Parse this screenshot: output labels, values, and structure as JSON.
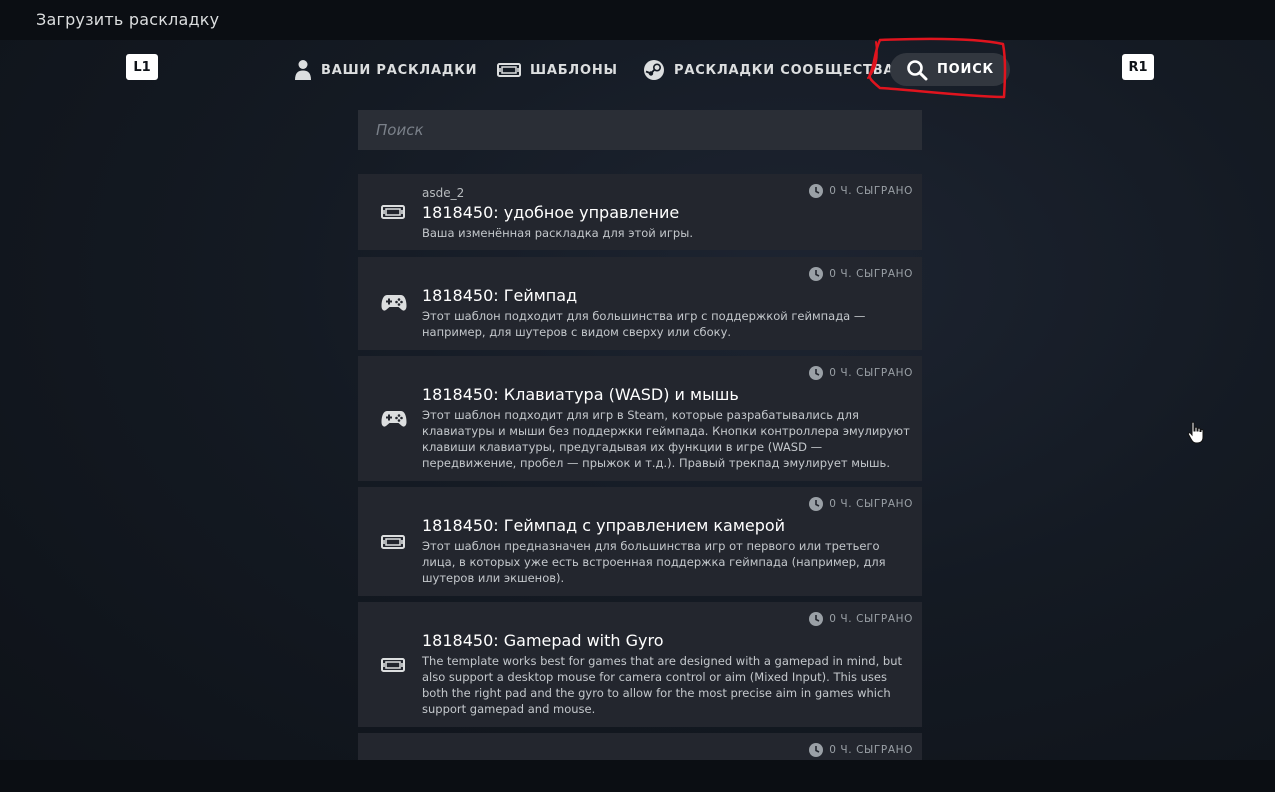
{
  "window": {
    "title": "Загрузить раскладку"
  },
  "shoulders": {
    "left": "L1",
    "right": "R1"
  },
  "tabs": [
    {
      "label": "ВАШИ РАСКЛАДКИ",
      "icon": "person-icon"
    },
    {
      "label": "ШАБЛОНЫ",
      "icon": "controller-outline-icon"
    },
    {
      "label": "РАСКЛАДКИ СООБЩЕСТВА",
      "icon": "steam-icon"
    },
    {
      "label": "ПОИСК",
      "icon": "search-icon",
      "active": true
    }
  ],
  "search": {
    "placeholder": "Поиск",
    "value": ""
  },
  "layouts": [
    {
      "author": "asde_2",
      "title": "1818450: удобное управление",
      "description": "Ваша изменённая раскладка для этой игры.",
      "played": "0 Ч. СЫГРАНО",
      "icon": "controller-outline-icon"
    },
    {
      "title": "1818450: Геймпад",
      "description": "Этот шаблон подходит для большинства игр с поддержкой геймпада — например, для шутеров с видом сверху или сбоку.",
      "played": "0 Ч. СЫГРАНО",
      "icon": "gamepad-icon"
    },
    {
      "title": "1818450: Клавиатура (WASD) и мышь",
      "description": "Этот шаблон подходит для игр в Steam, которые разрабатывались для клавиатуры и мыши без поддержки геймпада. Кнопки контроллера эмулируют клавиши клавиатуры, предугадывая их функции в игре (WASD — передвижение, пробел — прыжок и т.д.). Правый трекпад эмулирует мышь.",
      "played": "0 Ч. СЫГРАНО",
      "icon": "gamepad-icon"
    },
    {
      "title": "1818450: Геймпад с управлением камерой",
      "description": "Этот шаблон предназначен для большинства игр от первого или третьего лица, в которых уже есть встроенная поддержка геймпада (например, для шутеров или экшенов).",
      "played": "0 Ч. СЫГРАНО",
      "icon": "controller-outline-icon"
    },
    {
      "title": "1818450: Gamepad with Gyro",
      "description": "The template works best for games that are designed with a gamepad in mind, but also support a desktop mouse for camera control or aim (Mixed Input). This uses both the right pad and the gyro to allow for the most precise aim in games which support gamepad and mouse.",
      "played": "0 Ч. СЫГРАНО",
      "icon": "controller-outline-icon"
    },
    {
      "played": "0 Ч. СЫГРАНО"
    }
  ],
  "colors": {
    "background": "#141a23",
    "card": "#23262e",
    "active_tab": "#32373f",
    "annotation": "#e0141e"
  }
}
